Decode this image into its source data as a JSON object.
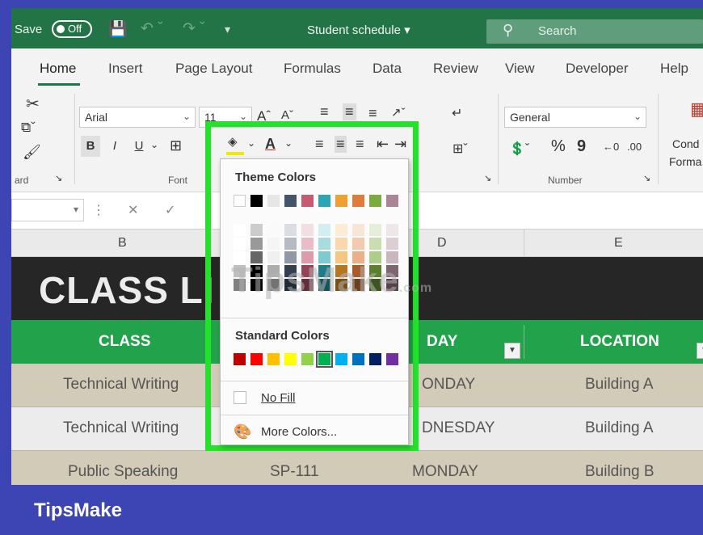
{
  "titlebar": {
    "autosave_label": "Save",
    "autosave_state": "Off",
    "doc_title": "Student schedule ▾",
    "search_placeholder": "Search"
  },
  "tabs": [
    "Home",
    "Insert",
    "Page Layout",
    "Formulas",
    "Data",
    "Review",
    "View",
    "Developer",
    "Help"
  ],
  "ribbon": {
    "font_name": "Arial",
    "font_size": "11",
    "number_format": "General",
    "clipboard_group_label": "ard",
    "font_group_label": "Font",
    "number_group_label": "Number",
    "conditional_label_1": "Cond",
    "conditional_label_2": "Forma",
    "bold": "B",
    "italic": "I",
    "underline": "U",
    "percent": "%",
    "comma": "9"
  },
  "columns": [
    "B",
    "D",
    "E"
  ],
  "sheet": {
    "banner_title": "CLASS LI",
    "headers": {
      "class": "CLASS",
      "day": "DAY",
      "location": "LOCATION"
    },
    "rows": [
      {
        "class": "Technical Writing",
        "day": "ONDAY",
        "location": "Building A"
      },
      {
        "class": "Technical Writing",
        "day": "DNESDAY",
        "location": "Building A"
      },
      {
        "class": "Public Speaking",
        "code": "SP-111",
        "day": "MONDAY",
        "location": "Building B"
      }
    ]
  },
  "fill_menu": {
    "theme_colors_label": "Theme Colors",
    "standard_colors_label": "Standard Colors",
    "no_fill_label": "No Fill",
    "more_colors_label": "More Colors...",
    "theme_colors": [
      "#ffffff",
      "#000000",
      "#e7e6e6",
      "#44546a",
      "#c55a72",
      "#2aa5b4",
      "#f0a030",
      "#e07b39",
      "#7aab3c",
      "#a98596"
    ],
    "standard_colors": [
      "#c00000",
      "#ff0000",
      "#ffc000",
      "#ffff00",
      "#92d050",
      "#00b050",
      "#00b0f0",
      "#0070c0",
      "#002060",
      "#7030a0"
    ]
  },
  "watermark": "TipsMake",
  "watermark_suffix": ".com",
  "brand": "TipsMake",
  "accent_colors": {
    "excel_green": "#227447",
    "highlight_green": "#22e22a",
    "frame_blue": "#3d45b5"
  }
}
